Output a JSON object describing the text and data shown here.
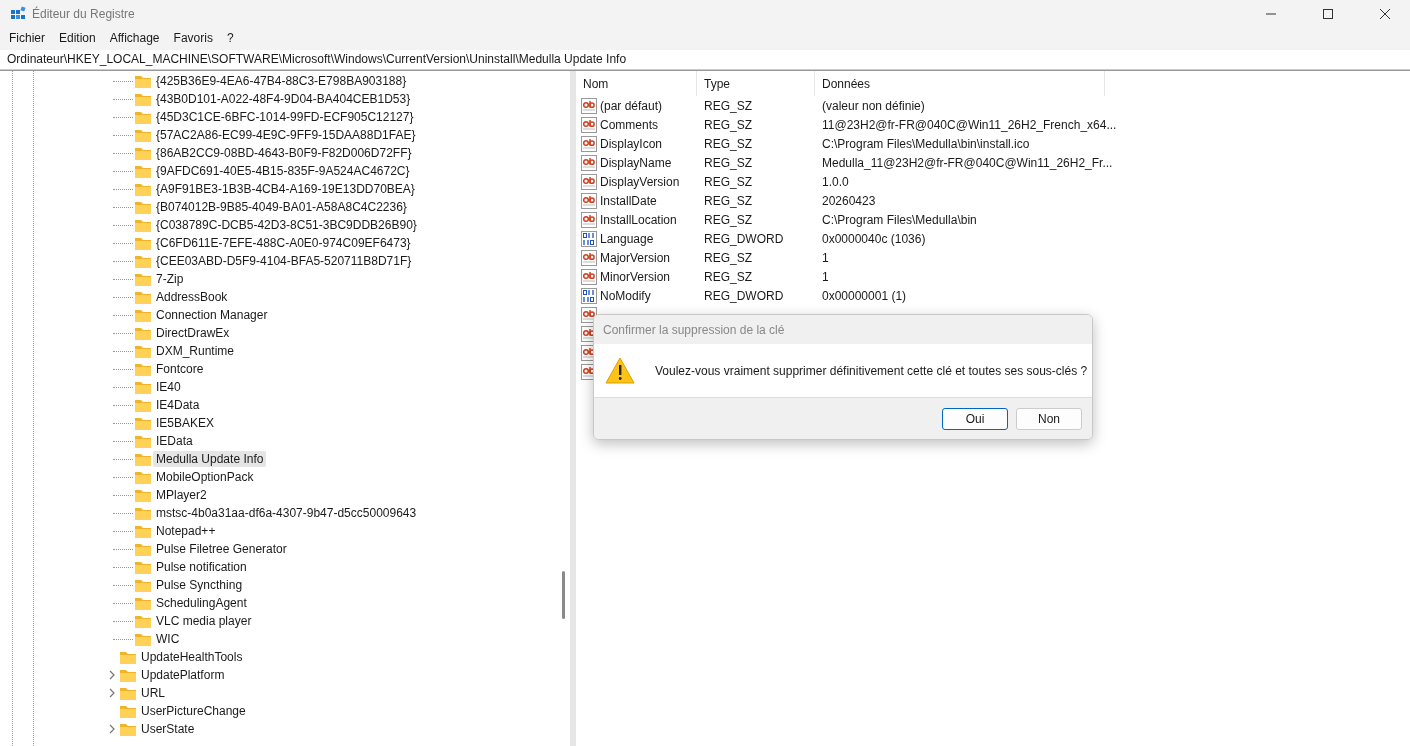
{
  "window": {
    "title": "Éditeur du Registre"
  },
  "menu": [
    "Fichier",
    "Edition",
    "Affichage",
    "Favoris",
    "?"
  ],
  "address": "Ordinateur\\HKEY_LOCAL_MACHINE\\SOFTWARE\\Microsoft\\Windows\\CurrentVersion\\Uninstall\\Medulla Update Info",
  "tree": [
    {
      "children": [
        {
          "label": "{425B36E9-4EA6-47B4-88C3-E798BA903188}",
          "selected": false
        },
        {
          "label": "{43B0D101-A022-48F4-9D04-BA404CEB1D53}",
          "selected": false
        },
        {
          "label": "{45D3C1CE-6BFC-1014-99FD-ECF905C12127}",
          "selected": false
        },
        {
          "label": "{57AC2A86-EC99-4E9C-9FF9-15DAA88D1FAE}",
          "selected": false
        },
        {
          "label": "{86AB2CC9-08BD-4643-B0F9-F82D006D72FF}",
          "selected": false
        },
        {
          "label": "{9AFDC691-40E5-4B15-835F-9A524AC4672C}",
          "selected": false
        },
        {
          "label": "{A9F91BE3-1B3B-4CB4-A169-19E13DD70BEA}",
          "selected": false
        },
        {
          "label": "{B074012B-9B85-4049-BA01-A58A8C4C2236}",
          "selected": false
        },
        {
          "label": "{C038789C-DCB5-42D3-8C51-3BC9DDB26B90}",
          "selected": false
        },
        {
          "label": "{C6FD611E-7EFE-488C-A0E0-974C09EF6473}",
          "selected": false
        },
        {
          "label": "{CEE03ABD-D5F9-4104-BFA5-520711B8D71F}",
          "selected": false
        },
        {
          "label": "7-Zip",
          "selected": false
        },
        {
          "label": "AddressBook",
          "selected": false
        },
        {
          "label": "Connection Manager",
          "selected": false
        },
        {
          "label": "DirectDrawEx",
          "selected": false
        },
        {
          "label": "DXM_Runtime",
          "selected": false
        },
        {
          "label": "Fontcore",
          "selected": false
        },
        {
          "label": "IE40",
          "selected": false
        },
        {
          "label": "IE4Data",
          "selected": false
        },
        {
          "label": "IE5BAKEX",
          "selected": false
        },
        {
          "label": "IEData",
          "selected": false
        },
        {
          "label": "Medulla Update Info",
          "selected": true
        },
        {
          "label": "MobileOptionPack",
          "selected": false
        },
        {
          "label": "MPlayer2",
          "selected": false
        },
        {
          "label": "mstsc-4b0a31aa-df6a-4307-9b47-d5cc50009643",
          "selected": false
        },
        {
          "label": "Notepad++",
          "selected": false
        },
        {
          "label": "Pulse Filetree Generator",
          "selected": false
        },
        {
          "label": "Pulse notification",
          "selected": false
        },
        {
          "label": "Pulse Syncthing",
          "selected": false
        },
        {
          "label": "SchedulingAgent",
          "selected": false
        },
        {
          "label": "VLC media player",
          "selected": false
        },
        {
          "label": "WIC",
          "selected": false
        }
      ]
    },
    {
      "label": "UpdateHealthTools",
      "selected": false,
      "expandable": false
    },
    {
      "label": "UpdatePlatform",
      "selected": false,
      "expandable": true
    },
    {
      "label": "URL",
      "selected": false,
      "expandable": true
    },
    {
      "label": "UserPictureChange",
      "selected": false,
      "expandable": false
    },
    {
      "label": "UserState",
      "selected": false,
      "expandable": true
    }
  ],
  "table": {
    "columns": [
      "Nom",
      "Type",
      "Données"
    ],
    "rows": [
      {
        "kind": "sz",
        "name": "(par défaut)",
        "type": "REG_SZ",
        "data": "(valeur non définie)"
      },
      {
        "kind": "sz",
        "name": "Comments",
        "type": "REG_SZ",
        "data": "11@23H2@fr-FR@040C@Win11_26H2_French_x64..."
      },
      {
        "kind": "sz",
        "name": "DisplayIcon",
        "type": "REG_SZ",
        "data": "C:\\Program Files\\Medulla\\bin\\install.ico"
      },
      {
        "kind": "sz",
        "name": "DisplayName",
        "type": "REG_SZ",
        "data": "Medulla_11@23H2@fr-FR@040C@Win11_26H2_Fr..."
      },
      {
        "kind": "sz",
        "name": "DisplayVersion",
        "type": "REG_SZ",
        "data": "1.0.0"
      },
      {
        "kind": "sz",
        "name": "InstallDate",
        "type": "REG_SZ",
        "data": "20260423"
      },
      {
        "kind": "sz",
        "name": "InstallLocation",
        "type": "REG_SZ",
        "data": "C:\\Program Files\\Medulla\\bin"
      },
      {
        "kind": "dword",
        "name": "Language",
        "type": "REG_DWORD",
        "data": "0x0000040c (1036)"
      },
      {
        "kind": "sz",
        "name": "MajorVersion",
        "type": "REG_SZ",
        "data": "1"
      },
      {
        "kind": "sz",
        "name": "MinorVersion",
        "type": "REG_SZ",
        "data": "1"
      },
      {
        "kind": "dword",
        "name": "NoModify",
        "type": "REG_DWORD",
        "data": "0x00000001 (1)"
      },
      {
        "kind": "sz"
      },
      {
        "kind": "sz"
      },
      {
        "kind": "sz"
      },
      {
        "kind": "sz"
      }
    ]
  },
  "dialog": {
    "title": "Confirmer la suppression de la clé",
    "message": "Voulez-vous vraiment supprimer définitivement cette clé et toutes ses sous-clés ?",
    "buttons": [
      {
        "label": "Oui",
        "default": true
      },
      {
        "label": "Non",
        "default": false
      }
    ]
  }
}
